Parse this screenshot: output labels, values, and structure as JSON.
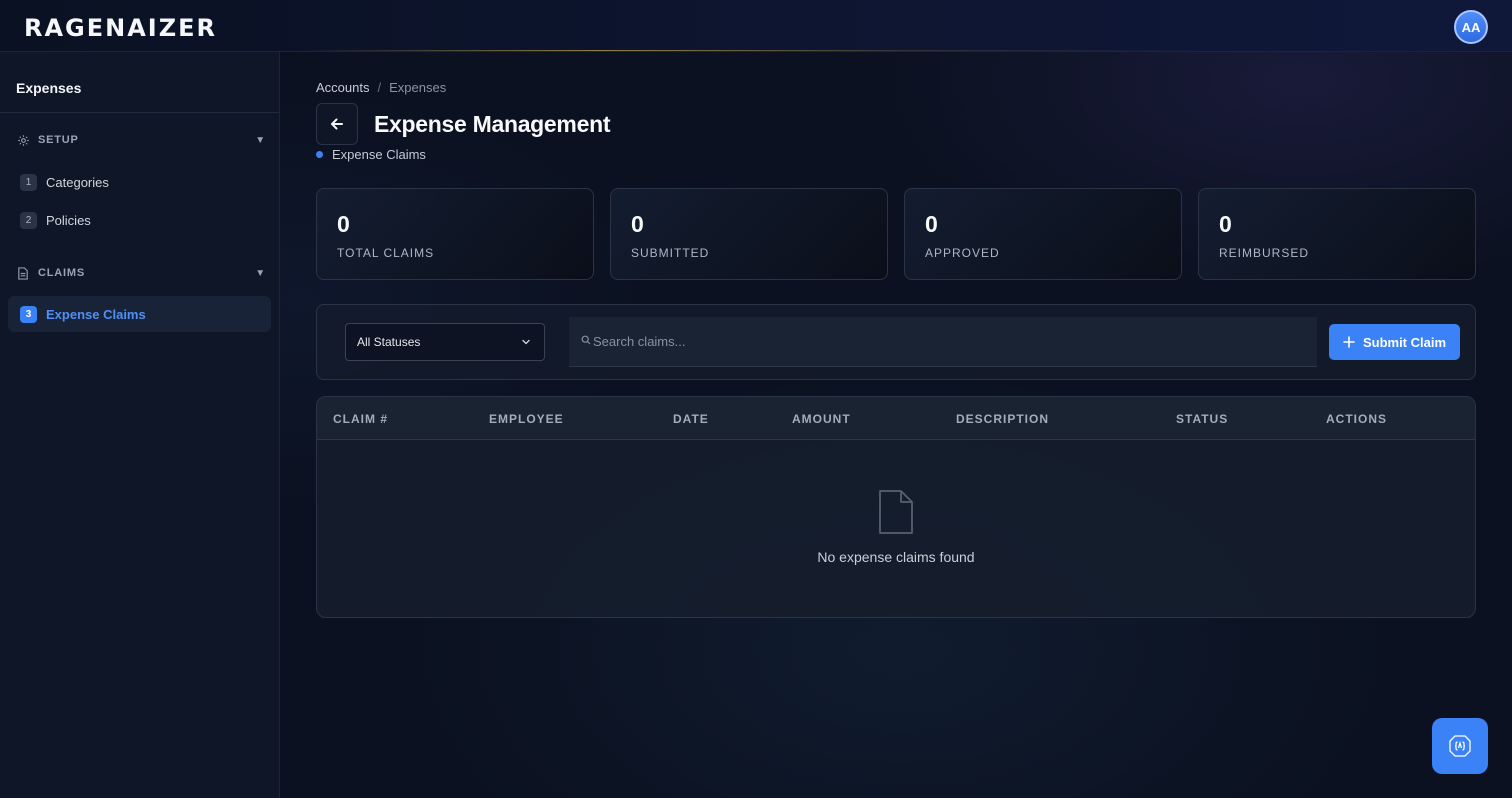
{
  "header": {
    "logo": "RAGENAIZER",
    "avatar_initials": "AA"
  },
  "sidebar": {
    "title": "Expenses",
    "sections": [
      {
        "label": "SETUP",
        "icon": "gear-icon",
        "items": [
          {
            "num": "1",
            "label": "Categories"
          },
          {
            "num": "2",
            "label": "Policies"
          }
        ]
      },
      {
        "label": "CLAIMS",
        "icon": "document-icon",
        "items": [
          {
            "num": "3",
            "label": "Expense Claims",
            "active": true
          }
        ]
      }
    ]
  },
  "breadcrumb": {
    "parent": "Accounts",
    "separator": "/",
    "current": "Expenses"
  },
  "page": {
    "title": "Expense Management",
    "subtitle": "Expense Claims"
  },
  "stats": [
    {
      "value": "0",
      "label": "TOTAL CLAIMS"
    },
    {
      "value": "0",
      "label": "SUBMITTED"
    },
    {
      "value": "0",
      "label": "APPROVED"
    },
    {
      "value": "0",
      "label": "REIMBURSED"
    }
  ],
  "filters": {
    "status_selected": "All Statuses",
    "search_placeholder": "Search claims...",
    "submit_label": "Submit Claim"
  },
  "table": {
    "columns": [
      "CLAIM #",
      "EMPLOYEE",
      "DATE",
      "AMOUNT",
      "DESCRIPTION",
      "STATUS",
      "ACTIONS"
    ],
    "empty_message": "No expense claims found"
  },
  "colors": {
    "accent": "#3b82f6",
    "background": "#0b1120",
    "sidebar": "#0e1628"
  }
}
